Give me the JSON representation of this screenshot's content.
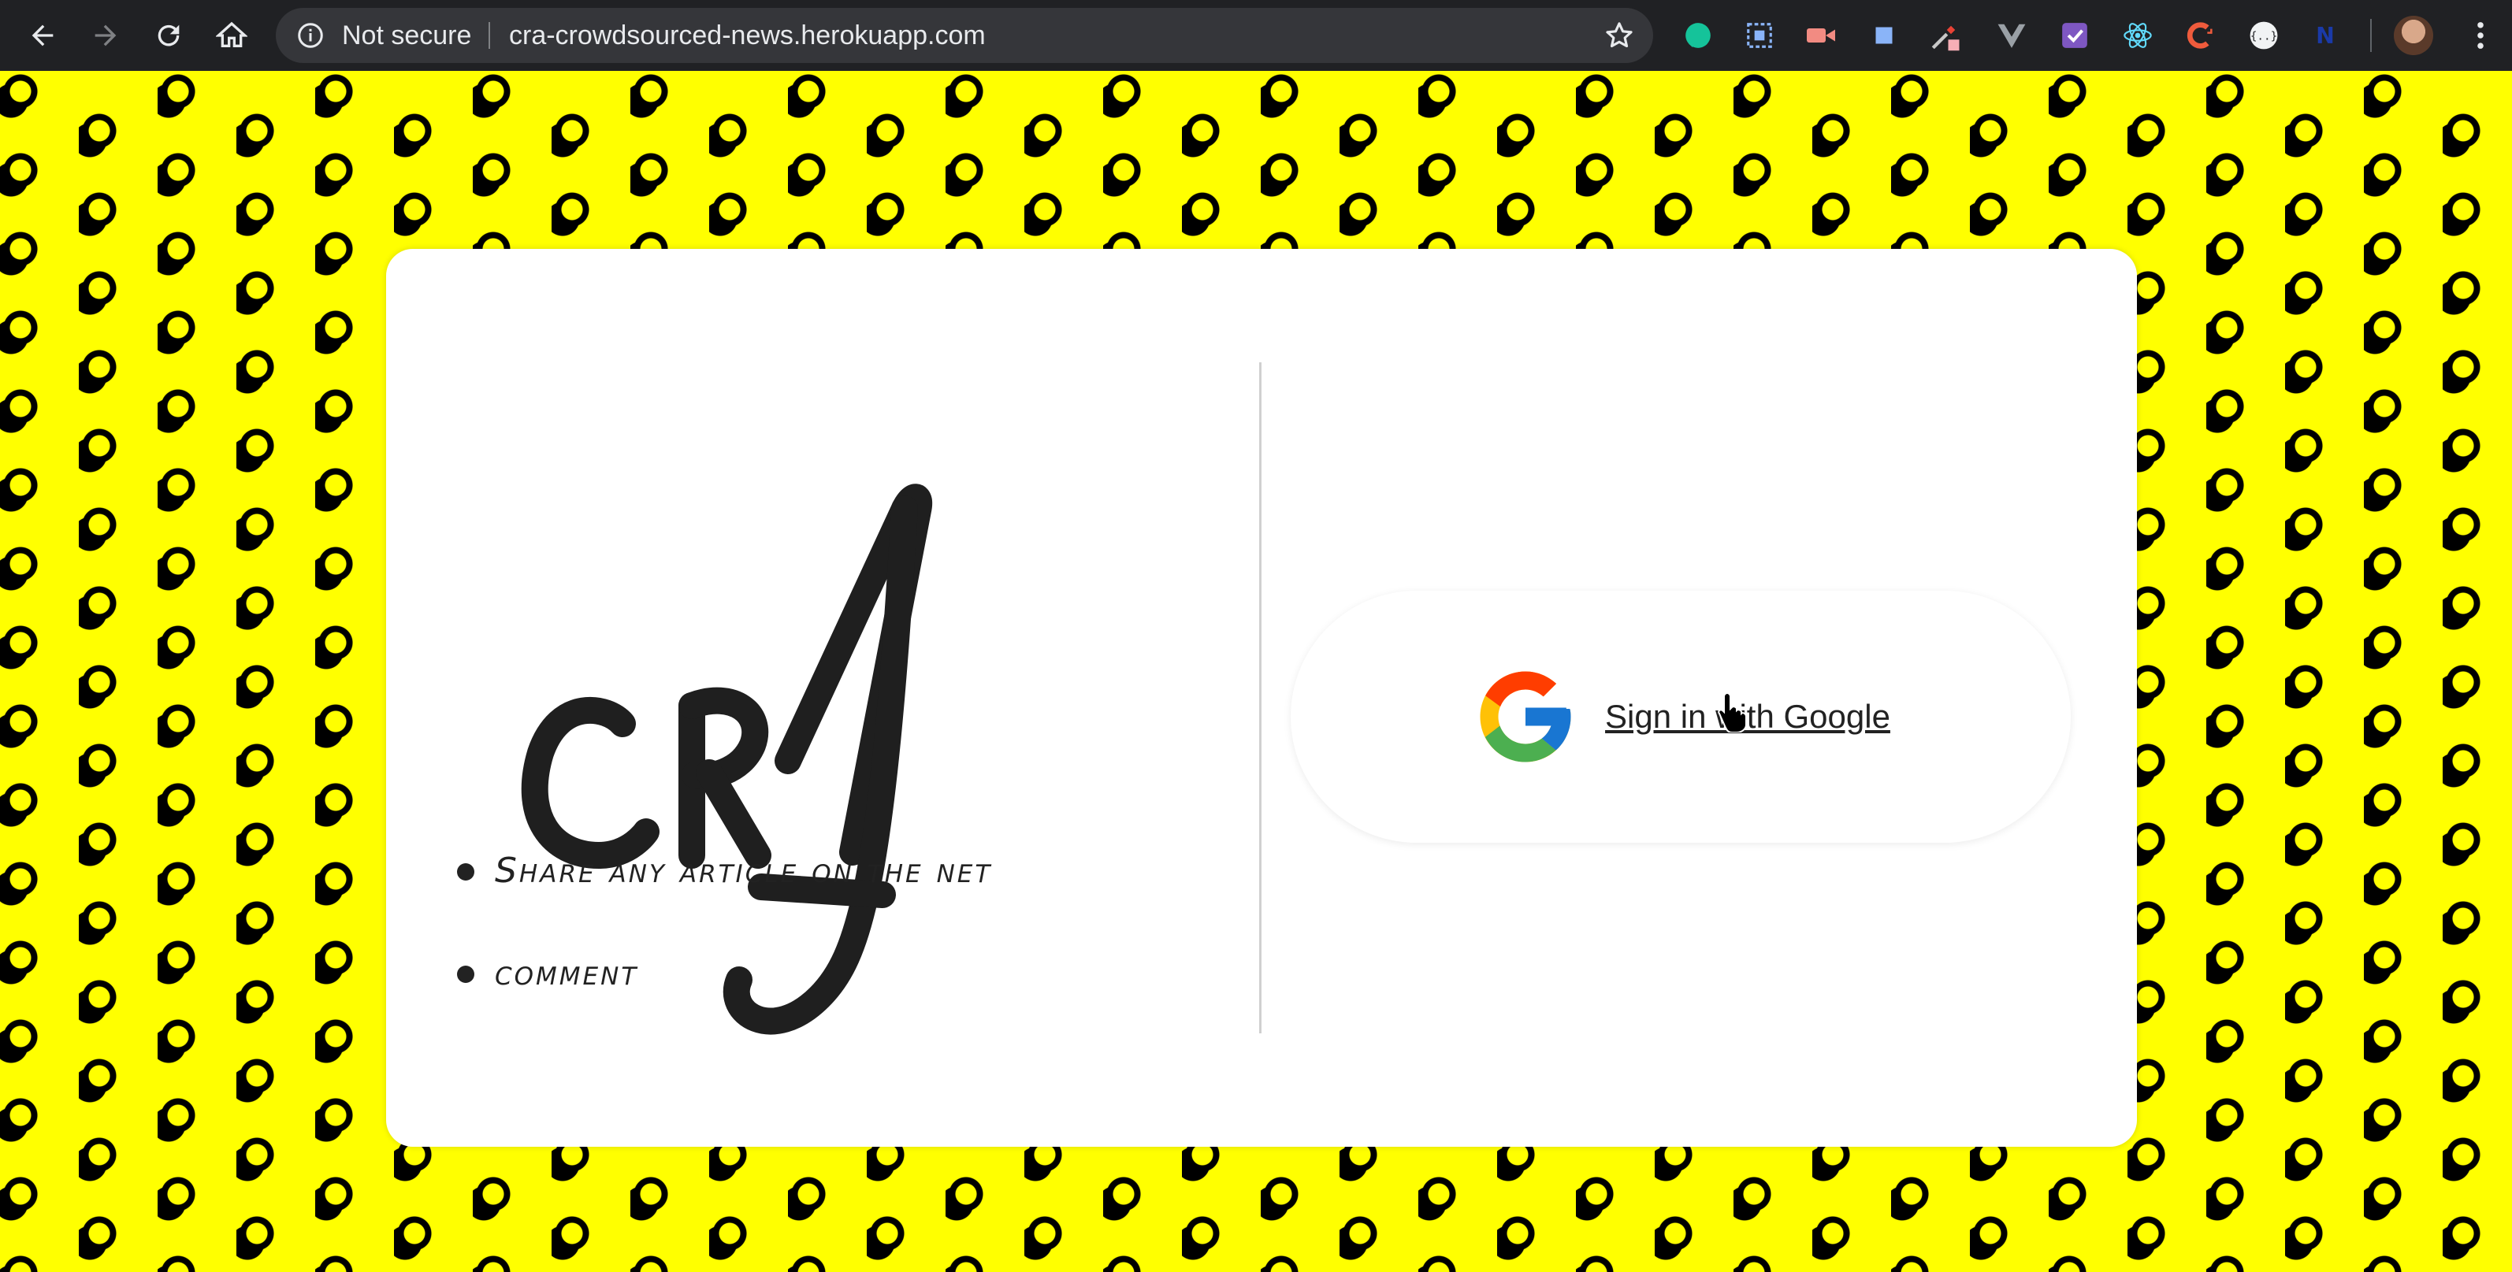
{
  "browser": {
    "security_label": "Not secure",
    "url": "cra-crowdsourced-news.herokuapp.com",
    "extensions": [
      "grammarly-icon",
      "screencast-icon",
      "video-icon",
      "blue-square-icon",
      "eyedropper-icon",
      "vue-icon",
      "checkmark-icon",
      "react-icon",
      "c-icon",
      "json-icon",
      "n-icon"
    ]
  },
  "page": {
    "logo_text": "CRA",
    "features": [
      "Share any article on the net",
      "comment"
    ],
    "signin_label": "Sign in with Google"
  },
  "colors": {
    "background": "#ffff00",
    "dots": "#000000",
    "card": "#ffffff",
    "text": "#222222"
  }
}
